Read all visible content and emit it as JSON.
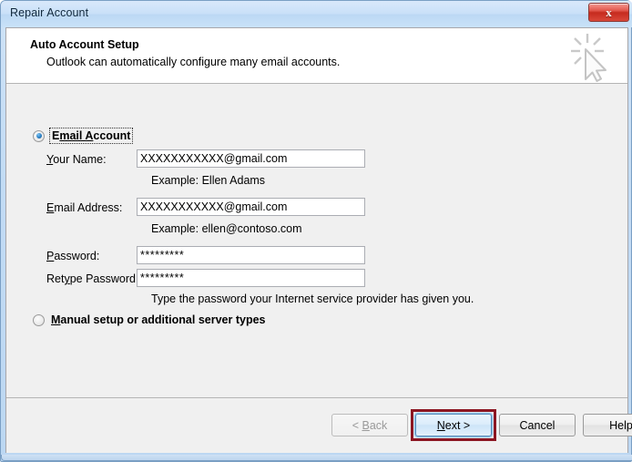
{
  "window": {
    "title": "Repair Account",
    "close_label": "x",
    "close_icon": "close-icon"
  },
  "header": {
    "title": "Auto Account Setup",
    "subtitle": "Outlook can automatically configure many email accounts.",
    "icon": "wizard-cursor-sparkle-icon"
  },
  "form": {
    "email_account": {
      "label_before": "E",
      "label_accel": "mail A",
      "label_after": "ccount",
      "label_full": "Email Account",
      "selected": true,
      "focused": true
    },
    "manual_setup": {
      "label_before": "",
      "label_accel": "M",
      "label_after": "anual setup or additional server types",
      "label_full": "Manual setup or additional server types",
      "selected": false
    },
    "fields": [
      {
        "name": "your-name",
        "label_before": "",
        "label_accel": "Y",
        "label_after": "our Name:",
        "label_full": "Your Name:",
        "value": "XXXXXXXXXXX@gmail.com",
        "hint": "Example: Ellen Adams",
        "type": "text"
      },
      {
        "name": "email-address",
        "label_before": "",
        "label_accel": "E",
        "label_after": "mail Address:",
        "label_full": "Email Address:",
        "value": "XXXXXXXXXXX@gmail.com",
        "hint": "Example: ellen@contoso.com",
        "type": "text"
      },
      {
        "name": "password",
        "label_before": "",
        "label_accel": "P",
        "label_after": "assword:",
        "label_full": "Password:",
        "value": "*********",
        "hint": "",
        "type": "password"
      },
      {
        "name": "retype-password",
        "label_before": "Ret",
        "label_accel": "y",
        "label_after": "pe Password:",
        "label_full": "Retype Password:",
        "value": "*********",
        "hint": "",
        "type": "password"
      }
    ],
    "password_hint": "Type the password your Internet service provider has given you."
  },
  "footer": {
    "buttons": [
      {
        "name": "back",
        "label_before": "< ",
        "label_accel": "B",
        "label_after": "ack",
        "label_full": "< Back",
        "disabled": true,
        "default": false
      },
      {
        "name": "next",
        "label_before": "",
        "label_accel": "N",
        "label_after": "ext >",
        "label_full": "Next >",
        "disabled": false,
        "default": true
      },
      {
        "name": "cancel",
        "label_before": "Cancel",
        "label_accel": "",
        "label_after": "",
        "label_full": "Cancel",
        "disabled": false,
        "default": false
      },
      {
        "name": "help",
        "label_before": "Help",
        "label_accel": "",
        "label_after": "",
        "label_full": "Help",
        "disabled": false,
        "default": false
      }
    ]
  },
  "annotation": {
    "target": "next-button",
    "color": "#8c1622"
  }
}
